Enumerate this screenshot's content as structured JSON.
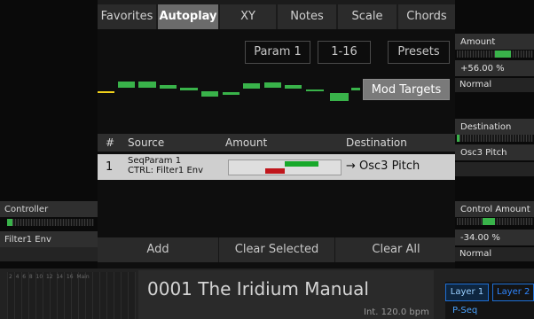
{
  "tabs": [
    {
      "label": "Favorites",
      "active": false
    },
    {
      "label": "Autoplay",
      "active": true
    },
    {
      "label": "XY",
      "active": false
    },
    {
      "label": "Notes",
      "active": false
    },
    {
      "label": "Scale",
      "active": false
    },
    {
      "label": "Chords",
      "active": false
    }
  ],
  "seq": {
    "param_button": "Param 1",
    "range_button": "1-16",
    "presets_button": "Presets",
    "mod_targets_button": "Mod Targets"
  },
  "mod_table": {
    "headers": {
      "index": "#",
      "source": "Source",
      "amount": "Amount",
      "destination": "Destination"
    },
    "rows": [
      {
        "index": "1",
        "source_line1": "SeqParam 1",
        "source_line2": "CTRL: Filter1 Env",
        "destination": "→ Osc3 Pitch"
      }
    ]
  },
  "actions": {
    "add": "Add",
    "clear_selected": "Clear Selected",
    "clear_all": "Clear All"
  },
  "left": {
    "controller_label": "Controller",
    "controller_value": "Filter1 Env"
  },
  "right": {
    "amount_label": "Amount",
    "amount_value": "+56.00 %",
    "amount_mode": "Normal",
    "destination_label": "Destination",
    "destination_value": "Osc3 Pitch",
    "control_amount_label": "Control Amount",
    "control_amount_value": "-34.00 %",
    "control_amount_mode": "Normal"
  },
  "bottom": {
    "meter_labels": "2  4  6  8  10  12  14  16  Main",
    "preset_title": "0001 The Iridium Manual",
    "tempo": "Int. 120.0 bpm",
    "layer1": "Layer 1",
    "layer2": "Layer 2",
    "layer_source": "P-Seq"
  },
  "colors": {
    "accent_green": "#39b34a",
    "accent_red": "#c0161c",
    "accent_yellow": "#f2d21b",
    "layer_blue": "#1e6fd6"
  }
}
